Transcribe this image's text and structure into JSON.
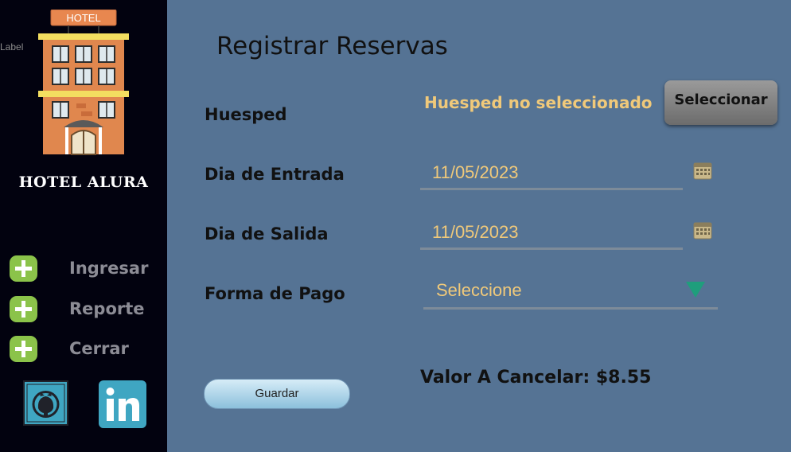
{
  "sidebar": {
    "tiny_label": "Label",
    "logo_sign": "HOTEL",
    "hotel_name": "HOTEL ALURA",
    "menu": [
      {
        "label": "Ingresar"
      },
      {
        "label": "Reporte"
      },
      {
        "label": "Cerrar"
      }
    ],
    "social": [
      "github-icon",
      "linkedin-icon"
    ]
  },
  "form": {
    "title": "Registrar Reservas",
    "guest_label": "Huesped",
    "guest_status": "Huesped no seleccionado",
    "select_button": "Seleccionar",
    "checkin_label": "Dia de Entrada",
    "checkin_value": "11/05/2023",
    "checkout_label": "Dia de Salida",
    "checkout_value": "11/05/2023",
    "payment_label": "Forma de Pago",
    "payment_value": "Seleccione",
    "total_label": "Valor A Cancelar:",
    "total_value": "$8.55",
    "save_button": "Guardar"
  },
  "colors": {
    "sidebar_bg": "#02020f",
    "content_bg": "#557394",
    "accent_text": "#f0c97a",
    "plus_icon": "#8bc34a",
    "linkedin": "#3fa6c2"
  }
}
